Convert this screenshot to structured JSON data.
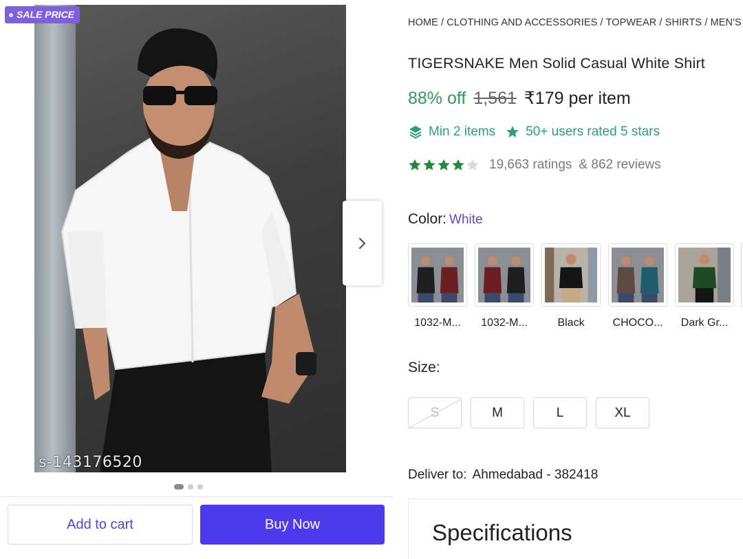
{
  "product": {
    "sale_badge": "SALE PRICE",
    "sku": "s-143176520",
    "breadcrumb": "HOME / CLOTHING AND ACCESSORIES / TOPWEAR / SHIRTS / MEN'S SHI",
    "title": "TIGERSNAKE Men Solid Casual White Shirt",
    "discount": "88% off",
    "mrp": "1,561",
    "price": "₹179 per item",
    "min_items": "Min 2 items",
    "users_rated": "50+ users rated 5 stars",
    "rating_stars": 4,
    "ratings_count": "19,663 ratings",
    "reviews_count": "& 862 reviews"
  },
  "carousel": {
    "total_images": 3,
    "active_index": 0
  },
  "color": {
    "label": "Color:",
    "selected": "White",
    "options": [
      {
        "label": "1032-M...",
        "shirts": [
          "#1e1e1e",
          "#6b1f22"
        ]
      },
      {
        "label": "1032-M...",
        "shirts": [
          "#6b1f22",
          "#1e1e1e"
        ]
      },
      {
        "label": "Black",
        "shirts": [
          "#151515"
        ]
      },
      {
        "label": "CHOCO...",
        "shirts": [
          "#5e4a42",
          "#1f5d6a"
        ]
      },
      {
        "label": "Dark Gr...",
        "shirts": [
          "#1f4a26"
        ]
      }
    ]
  },
  "size": {
    "label": "Size:",
    "options": [
      {
        "label": "S",
        "available": false
      },
      {
        "label": "M",
        "available": true
      },
      {
        "label": "L",
        "available": true
      },
      {
        "label": "XL",
        "available": true
      }
    ]
  },
  "delivery": {
    "label": "Deliver to:",
    "location": "Ahmedabad - 382418"
  },
  "section": {
    "specifications": "Specifications"
  },
  "actions": {
    "add_to_cart": "Add to cart",
    "buy_now": "Buy Now"
  },
  "colors": {
    "accent": "#4c3aec",
    "accent_text": "#5b3fc8",
    "discount_green": "#2f9a5a",
    "badge_teal": "#2aa079",
    "star_green": "#1f8a3a",
    "sale_purple": "#7f5fe0"
  }
}
